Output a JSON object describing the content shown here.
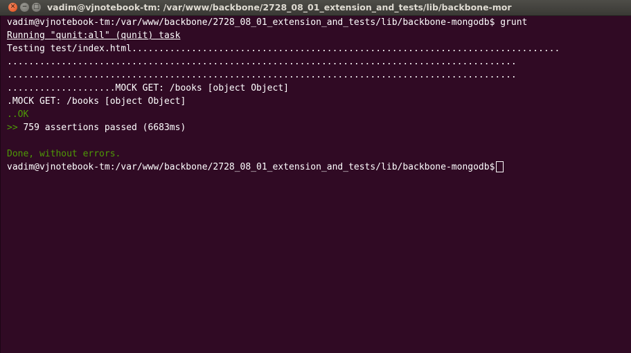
{
  "window": {
    "title": "vadim@vjnotebook-tm: /var/www/backbone/2728_08_01_extension_and_tests/lib/backbone-mor",
    "close_glyph": "✕",
    "minimize_glyph": "−",
    "maximize_glyph": "□"
  },
  "terminal": {
    "line1_prompt": "vadim@vjnotebook-tm:/var/www/backbone/2728_08_01_extension_and_tests/lib/backbone-mongodb$",
    "line1_command": " grunt",
    "line2": "Running \"qunit:all\" (qunit) task",
    "line3": "Testing test/index.html...............................................................................",
    "line4": "..............................................................................................",
    "line5": "..............................................................................................",
    "line6": "....................MOCK GET: /books [object Object]",
    "line7": ".MOCK GET: /books [object Object]",
    "line8_dots": "..",
    "line8_ok": "OK",
    "line9_arrow": ">>",
    "line9_text": " 759 assertions passed (6683ms)",
    "line10": "",
    "line11": "Done, without errors.",
    "line12_prompt": "vadim@vjnotebook-tm:/var/www/backbone/2728_08_01_extension_and_tests/lib/backbone-mongodb$"
  },
  "colors": {
    "background": "#300a24",
    "text": "#ffffff",
    "success": "#4e9a06"
  }
}
